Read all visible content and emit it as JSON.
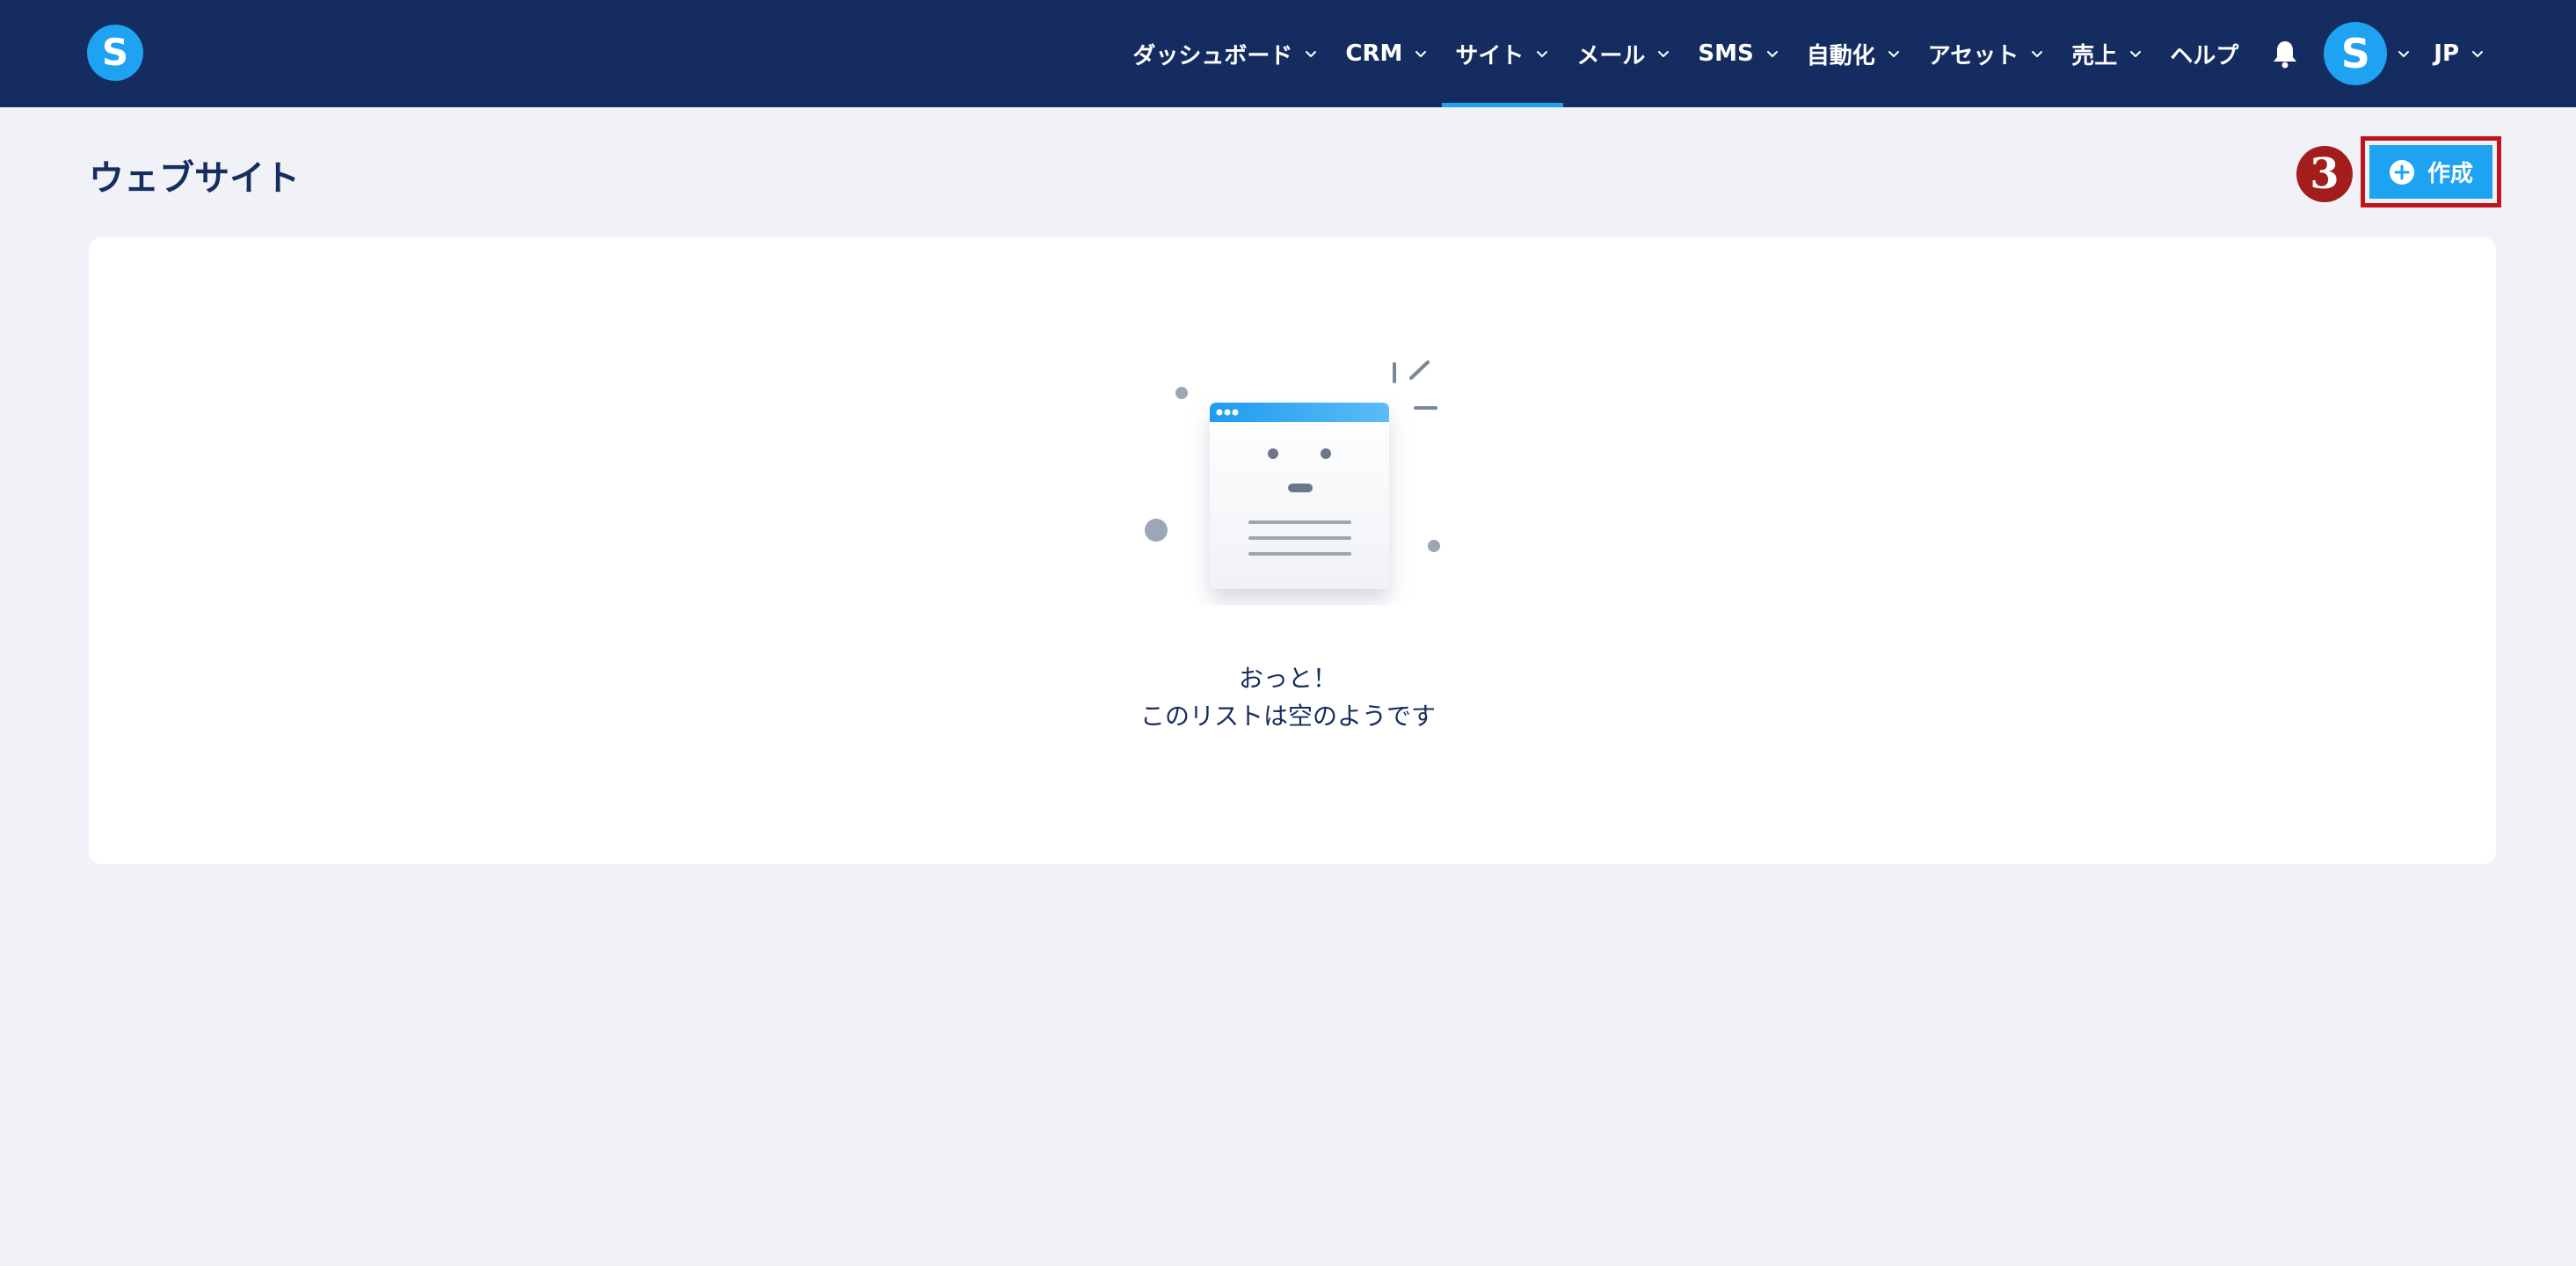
{
  "app": {
    "logo_letter": "S"
  },
  "nav": {
    "items": [
      {
        "label": "ダッシュボード",
        "active": false
      },
      {
        "label": "CRM",
        "active": false
      },
      {
        "label": "サイト",
        "active": true
      },
      {
        "label": "メール",
        "active": false
      },
      {
        "label": "SMS",
        "active": false
      },
      {
        "label": "自動化",
        "active": false
      },
      {
        "label": "アセット",
        "active": false
      },
      {
        "label": "売上",
        "active": false
      },
      {
        "label": "ヘルプ",
        "active": false
      }
    ],
    "avatar_letter": "S",
    "language": "JP"
  },
  "page": {
    "title": "ウェブサイト",
    "step_number": "3",
    "create_label": "作成"
  },
  "empty_state": {
    "title": "おっと！",
    "subtitle": "このリストは空のようです"
  },
  "colors": {
    "topbar": "#152c60",
    "accent": "#1ea3f2",
    "highlight": "#c2151b",
    "step_badge": "#a31d1d",
    "background": "#f1f2f7"
  },
  "icons": {
    "bell": "bell-icon",
    "chevron": "chevron-down-icon",
    "plus": "plus-circle-icon"
  }
}
